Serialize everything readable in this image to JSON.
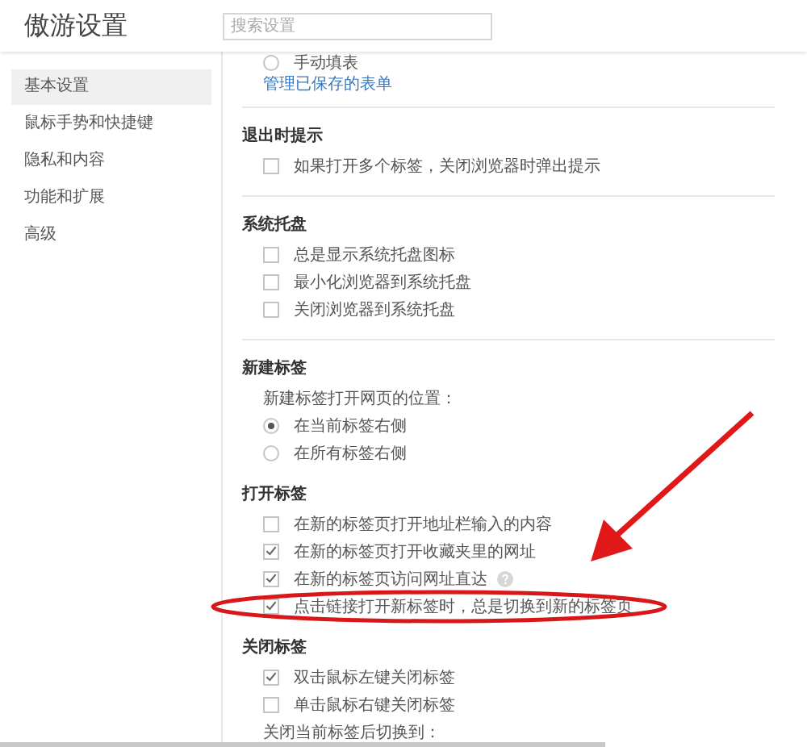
{
  "window": {
    "title": "傲游设置"
  },
  "search": {
    "placeholder": "搜索设置"
  },
  "sidebar": {
    "items": [
      {
        "label": "基本设置",
        "selected": true
      },
      {
        "label": "鼠标手势和快捷键",
        "selected": false
      },
      {
        "label": "隐私和内容",
        "selected": false
      },
      {
        "label": "功能和扩展",
        "selected": false
      },
      {
        "label": "高级",
        "selected": false
      }
    ]
  },
  "sections": [
    {
      "divider_after": true,
      "items": [
        {
          "kind": "radio",
          "label": "手动填表",
          "selected": false
        },
        {
          "kind": "link",
          "label": "管理已保存的表单"
        }
      ]
    },
    {
      "heading": "退出时提示",
      "divider_after": true,
      "items": [
        {
          "kind": "checkbox",
          "label": "如果打开多个标签，关闭浏览器时弹出提示",
          "checked": false
        }
      ]
    },
    {
      "heading": "系统托盘",
      "divider_after": true,
      "items": [
        {
          "kind": "checkbox",
          "label": "总是显示系统托盘图标",
          "checked": false
        },
        {
          "kind": "checkbox",
          "label": "最小化浏览器到系统托盘",
          "checked": false
        },
        {
          "kind": "checkbox",
          "label": "关闭浏览器到系统托盘",
          "checked": false
        }
      ]
    },
    {
      "heading": "新建标签",
      "items": [
        {
          "kind": "label",
          "label": "新建标签打开网页的位置："
        },
        {
          "kind": "radio",
          "label": "在当前标签右侧",
          "selected": true
        },
        {
          "kind": "radio",
          "label": "在所有标签右侧",
          "selected": false
        }
      ]
    },
    {
      "heading": "打开标签",
      "items": [
        {
          "kind": "checkbox",
          "label": "在新的标签页打开地址栏输入的内容",
          "checked": false
        },
        {
          "kind": "checkbox",
          "label": "在新的标签页打开收藏夹里的网址",
          "checked": true
        },
        {
          "kind": "checkbox",
          "label": "在新的标签页访问网址直达",
          "checked": true,
          "help": true
        },
        {
          "kind": "checkbox",
          "label": "点击链接打开新标签时，总是切换到新的标签页",
          "checked": true
        }
      ]
    },
    {
      "heading": "关闭标签",
      "items": [
        {
          "kind": "checkbox",
          "label": "双击鼠标左键关闭标签",
          "checked": true
        },
        {
          "kind": "checkbox",
          "label": "单击鼠标右键关闭标签",
          "checked": false
        },
        {
          "kind": "label",
          "label": "关闭当前标签后切换到："
        }
      ]
    }
  ]
}
